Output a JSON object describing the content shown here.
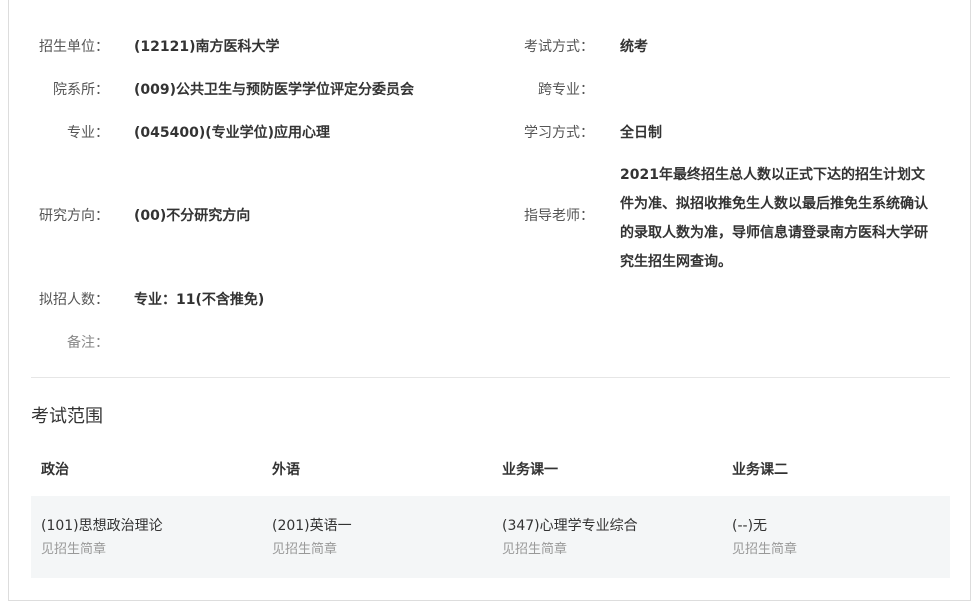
{
  "info": {
    "unit_label": "招生单位：",
    "unit_value": "(12121)南方医科大学",
    "exam_mode_label": "考试方式：",
    "exam_mode_value": "统考",
    "dept_label": "院系所：",
    "dept_value": "(009)公共卫生与预防医学学位评定分委员会",
    "cross_major_label": "跨专业：",
    "cross_major_value": "",
    "major_label": "专业：",
    "major_value": "(045400)(专业学位)应用心理",
    "study_mode_label": "学习方式：",
    "study_mode_value": "全日制",
    "direction_label": "研究方向：",
    "direction_value": "(00)不分研究方向",
    "supervisor_label": "指导老师：",
    "supervisor_value": "2021年最终招生总人数以正式下达的招生计划文件为准、拟招收推免生人数以最后推免生系统确认的录取人数为准，导师信息请登录南方医科大学研究生招生网查询。",
    "quota_label": "拟招人数：",
    "quota_value": "专业：11(不含推免)",
    "remark_label": "备注：",
    "remark_value": ""
  },
  "exam_scope": {
    "title": "考试范围",
    "columns": [
      {
        "header": "政治",
        "subject": "(101)思想政治理论",
        "note": "见招生简章"
      },
      {
        "header": "外语",
        "subject": "(201)英语一",
        "note": "见招生简章"
      },
      {
        "header": "业务课一",
        "subject": "(347)心理学专业综合",
        "note": "见招生简章"
      },
      {
        "header": "业务课二",
        "subject": "(--)无",
        "note": "见招生简章"
      }
    ]
  }
}
